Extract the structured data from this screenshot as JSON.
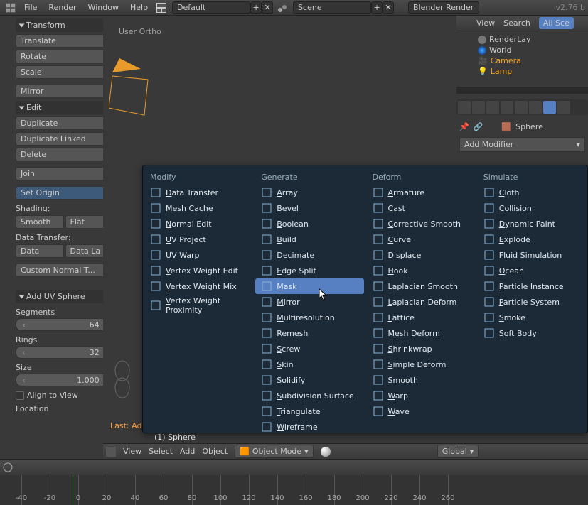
{
  "top": {
    "menus": [
      "File",
      "Render",
      "Window",
      "Help"
    ],
    "layout": "Default",
    "scene": "Scene",
    "engine": "Blender Render",
    "version": "v2.76 b"
  },
  "left": {
    "transform": {
      "title": "Transform",
      "items": [
        "Translate",
        "Rotate",
        "Scale"
      ],
      "mirror": "Mirror"
    },
    "edit": {
      "title": "Edit",
      "items": [
        "Duplicate",
        "Duplicate Linked",
        "Delete",
        "Join"
      ],
      "set_origin": "Set Origin"
    },
    "shading_label": "Shading:",
    "shading": [
      "Smooth",
      "Flat"
    ],
    "dt_label": "Data Transfer:",
    "dt": [
      "Data",
      "Data La"
    ],
    "custom": "Custom Normal T...",
    "add_uv": {
      "title": "Add UV Sphere",
      "segments_label": "Segments",
      "segments": "64",
      "rings_label": "Rings",
      "rings": "32",
      "size_label": "Size",
      "size": "1.000",
      "align": "Align to View",
      "location": "Location"
    }
  },
  "viewport": {
    "persp": "User Ortho",
    "last": "Last: Add UV Sphere",
    "active": "(1) Sphere"
  },
  "right": {
    "tabs": [
      "View",
      "Search",
      "All Sce"
    ],
    "outliner": [
      {
        "name": "RenderLay",
        "icon": "render"
      },
      {
        "name": "World",
        "icon": "world"
      },
      {
        "name": "Camera",
        "icon": "camera"
      },
      {
        "name": "Lamp",
        "icon": "lamp"
      }
    ],
    "obj": "Sphere",
    "add_modifier": "Add Modifier"
  },
  "mod": {
    "cols": [
      {
        "title": "Modify",
        "items": [
          "Data Transfer",
          "Mesh Cache",
          "Normal Edit",
          "UV Project",
          "UV Warp",
          "Vertex Weight Edit",
          "Vertex Weight Mix",
          "Vertex Weight Proximity"
        ]
      },
      {
        "title": "Generate",
        "items": [
          "Array",
          "Bevel",
          "Boolean",
          "Build",
          "Decimate",
          "Edge Split",
          "Mask",
          "Mirror",
          "Multiresolution",
          "Remesh",
          "Screw",
          "Skin",
          "Solidify",
          "Subdivision Surface",
          "Triangulate",
          "Wireframe"
        ]
      },
      {
        "title": "Deform",
        "items": [
          "Armature",
          "Cast",
          "Corrective Smooth",
          "Curve",
          "Displace",
          "Hook",
          "Laplacian Smooth",
          "Laplacian Deform",
          "Lattice",
          "Mesh Deform",
          "Shrinkwrap",
          "Simple Deform",
          "Smooth",
          "Warp",
          "Wave"
        ]
      },
      {
        "title": "Simulate",
        "items": [
          "Cloth",
          "Collision",
          "Dynamic Paint",
          "Explode",
          "Fluid Simulation",
          "Ocean",
          "Particle Instance",
          "Particle System",
          "Smoke",
          "Soft Body"
        ]
      }
    ],
    "highlight": "Mask"
  },
  "v3d": {
    "menus": [
      "View",
      "Select",
      "Add",
      "Object"
    ],
    "mode": "Object Mode",
    "orient": "Global"
  },
  "timeline": {
    "ticks": [
      "-40",
      "-20",
      "0",
      "20",
      "40",
      "60",
      "80",
      "100",
      "120",
      "140",
      "160",
      "180",
      "200",
      "220",
      "240",
      "260"
    ]
  }
}
